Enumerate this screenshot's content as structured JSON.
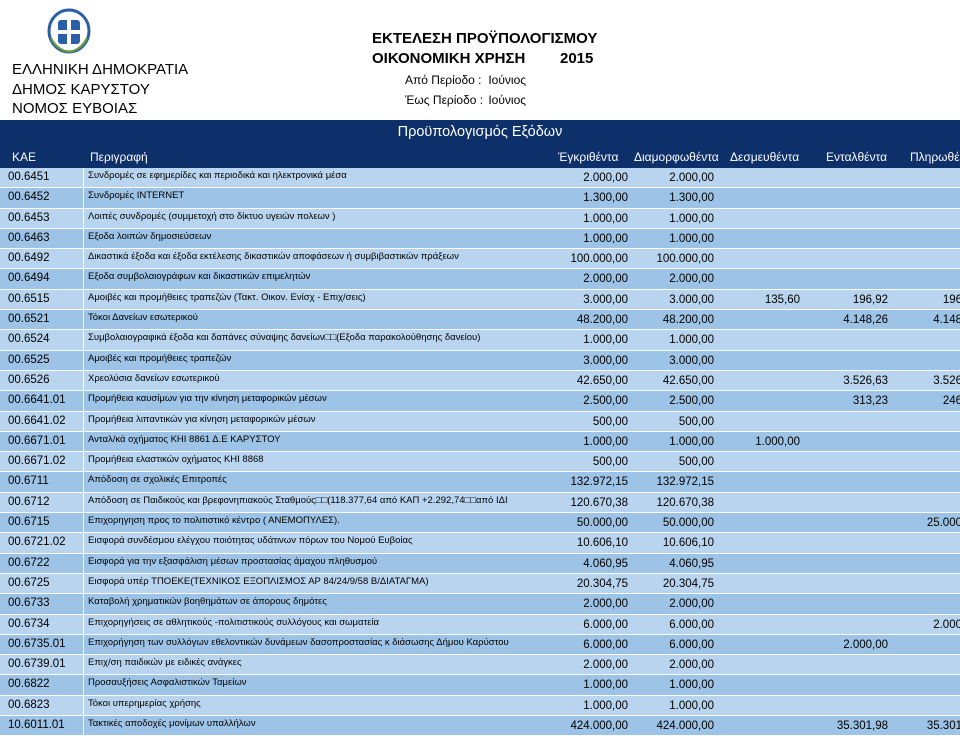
{
  "header": {
    "org_lines": [
      "ΕΛΛΗΝΙΚΗ ΔΗΜΟΚΡΑΤΙΑ",
      "ΔΗΜΟΣ ΚΑΡΥΣΤΟΥ",
      "ΝΟΜΟΣ ΕΥΒΟΙΑΣ"
    ],
    "report_title": "ΕΚΤΕΛΕΣΗ ΠΡΟΫΠΟΛΟΓΙΣΜΟΥ",
    "fiscal_year_label": "ΟΙΚΟΝΟΜΙΚΗ ΧΡΗΣΗ",
    "fiscal_year": "2015",
    "period_from_label": "Από Περίοδο :",
    "period_from": "Ιούνιος",
    "period_to_label": "Έως Περίοδο :",
    "period_to": "Ιούνιος",
    "emblem_icon": "greek-coat-of-arms-icon"
  },
  "section_title": "Προϋπολογισμός Εξόδων",
  "columns": [
    "ΚΑΕ",
    "Περιγραφή",
    "Έγκριθέντα",
    "Διαμορφωθέντα",
    "Δεσμευθέντα",
    "Ενταλθέντα",
    "Πληρωθέ"
  ],
  "colors": {
    "header_bar": "#0d2f6a",
    "row_light": "#b8d4ee",
    "row_dark": "#9dc3e6"
  },
  "rows": [
    {
      "code": "00.6451",
      "desc": "Συνδρομές σε εφημερίδες και περιοδικά και ηλεκτρονικά μέσα",
      "approved": "2.000,00",
      "revised": "2.000,00",
      "committed": "",
      "paid_order": "",
      "paid": ""
    },
    {
      "code": "00.6452",
      "desc": "Συνδρομές INTERNET",
      "approved": "1.300,00",
      "revised": "1.300,00",
      "committed": "",
      "paid_order": "",
      "paid": ""
    },
    {
      "code": "00.6453",
      "desc": "Λοιπές συνδρομές (συμμετοχή στο δίκτυο υγειών πολεων )",
      "approved": "1.000,00",
      "revised": "1.000,00",
      "committed": "",
      "paid_order": "",
      "paid": ""
    },
    {
      "code": "00.6463",
      "desc": "Εξοδα λοιπών δημοσιεύσεων",
      "approved": "1.000,00",
      "revised": "1.000,00",
      "committed": "",
      "paid_order": "",
      "paid": ""
    },
    {
      "code": "00.6492",
      "desc": "Δικαστικά έξοδα και έξοδα εκτέλεσης δικαστικών αποφάσεων ή συμβιβαστικών πράξεων",
      "approved": "100.000,00",
      "revised": "100.000,00",
      "committed": "",
      "paid_order": "",
      "paid": ""
    },
    {
      "code": "00.6494",
      "desc": "Εξοδα συμβολαιογράφων και δικαστικών επιμελητών",
      "approved": "2.000,00",
      "revised": "2.000,00",
      "committed": "",
      "paid_order": "",
      "paid": ""
    },
    {
      "code": "00.6515",
      "desc": "Αμοιβές και προμήθειες τραπεζών (Τακτ. Οικον. Ενίσχ - Επιχ/σεις)",
      "approved": "3.000,00",
      "revised": "3.000,00",
      "committed": "135,60",
      "paid_order": "196,92",
      "paid": "196"
    },
    {
      "code": "00.6521",
      "desc": "Τόκοι Δανείων εσωτερικού",
      "approved": "48.200,00",
      "revised": "48.200,00",
      "committed": "",
      "paid_order": "4.148,26",
      "paid": "4.148"
    },
    {
      "code": "00.6524",
      "desc": "Συμβολαιογραφικά έξοδα και δαπάνες σύναψης δανείων□□(Εξοδα παρακολούθησης δανείου)",
      "approved": "1.000,00",
      "revised": "1.000,00",
      "committed": "",
      "paid_order": "",
      "paid": ""
    },
    {
      "code": "00.6525",
      "desc": "Αμοιβές και προμήθειες τραπεζών",
      "approved": "3.000,00",
      "revised": "3.000,00",
      "committed": "",
      "paid_order": "",
      "paid": ""
    },
    {
      "code": "00.6526",
      "desc": "Χρεολύσια δανείων εσωτερικού",
      "approved": "42.650,00",
      "revised": "42.650,00",
      "committed": "",
      "paid_order": "3.526,63",
      "paid": "3.526"
    },
    {
      "code": "00.6641.01",
      "desc": "Προμήθεια καυσίμων για την κίνηση μεταφορικών μέσων",
      "approved": "2.500,00",
      "revised": "2.500,00",
      "committed": "",
      "paid_order": "313,23",
      "paid": "246"
    },
    {
      "code": "00.6641.02",
      "desc": "Προμήθεια λιπαντικών για κίνηση μεταφορικών μέσων",
      "approved": "500,00",
      "revised": "500,00",
      "committed": "",
      "paid_order": "",
      "paid": ""
    },
    {
      "code": "00.6671.01",
      "desc": "Ανταλ/κά οχήματος ΚΗΙ 8861 Δ.Ε ΚΑΡΥΣΤΟΥ",
      "approved": "1.000,00",
      "revised": "1.000,00",
      "committed": "1.000,00",
      "paid_order": "",
      "paid": ""
    },
    {
      "code": "00.6671.02",
      "desc": "Προμήθεια ελαστικών οχήματος ΚΗΙ 8868",
      "approved": "500,00",
      "revised": "500,00",
      "committed": "",
      "paid_order": "",
      "paid": ""
    },
    {
      "code": "00.6711",
      "desc": "Απόδοση σε σχολικές Επιτροπές",
      "approved": "132.972,15",
      "revised": "132.972,15",
      "committed": "",
      "paid_order": "",
      "paid": ""
    },
    {
      "code": "00.6712",
      "desc": "Απόδοση σε Παιδικούς και βρεφονηπιακούς Σταθμούς□□(118.377,64 από ΚΑΠ +2.292,74□□από ΙΔΙ",
      "approved": "120.670,38",
      "revised": "120.670,38",
      "committed": "",
      "paid_order": "",
      "paid": ""
    },
    {
      "code": "00.6715",
      "desc": "Επιχορηγηση προς το πολιτιστικό κέντρο ( ΑΝΕΜΟΠΥΛΕΣ).",
      "approved": "50.000,00",
      "revised": "50.000,00",
      "committed": "",
      "paid_order": "",
      "paid": "25.000"
    },
    {
      "code": "00.6721.02",
      "desc": "Εισφορά συνδέσμου ελέγχου ποιότητας υδάτινων πόρων του Νομού Ευβοίας",
      "approved": "10.606,10",
      "revised": "10.606,10",
      "committed": "",
      "paid_order": "",
      "paid": ""
    },
    {
      "code": "00.6722",
      "desc": "Εισφορά για την εξασφάλιση μέσων προστασίας άμαχου πληθυσμού",
      "approved": "4.060,95",
      "revised": "4.060,95",
      "committed": "",
      "paid_order": "",
      "paid": ""
    },
    {
      "code": "00.6725",
      "desc": "Εισφορά υπέρ ΤΠΟΕΚΕ(ΤΕΧΝΙΚΟΣ ΕΞΟΠΛΙΣΜΟΣ ΑΡ 84/24/9/58 Β/ΔΙΑΤΑΓΜΑ)",
      "approved": "20.304,75",
      "revised": "20.304,75",
      "committed": "",
      "paid_order": "",
      "paid": ""
    },
    {
      "code": "00.6733",
      "desc": "Καταβολή χρηματικών βοηθημάτων σε άπορους δημότες",
      "approved": "2.000,00",
      "revised": "2.000,00",
      "committed": "",
      "paid_order": "",
      "paid": ""
    },
    {
      "code": "00.6734",
      "desc": "Επιχορηγήσεις σε αθλητικούς -πολιτιστικούς συλλόγους και σωματεία",
      "approved": "6.000,00",
      "revised": "6.000,00",
      "committed": "",
      "paid_order": "",
      "paid": "2.000"
    },
    {
      "code": "00.6735.01",
      "desc": "Επιχορήγηση των συλλόγων εθελοντικών δυνάμεων δασοπροστασίας κ διάσωσης Δήμου Καρύστου",
      "approved": "6.000,00",
      "revised": "6.000,00",
      "committed": "",
      "paid_order": "2.000,00",
      "paid": ""
    },
    {
      "code": "00.6739.01",
      "desc": "Επιχ/ση παιδικών με ειδικές ανάγκες",
      "approved": "2.000,00",
      "revised": "2.000,00",
      "committed": "",
      "paid_order": "",
      "paid": ""
    },
    {
      "code": "00.6822",
      "desc": "Προσαυξήσεις Ασφαλιστικών Ταμείων",
      "approved": "1.000,00",
      "revised": "1.000,00",
      "committed": "",
      "paid_order": "",
      "paid": ""
    },
    {
      "code": "00.6823",
      "desc": "Τόκοι υπερημερίας χρήσης",
      "approved": "1.000,00",
      "revised": "1.000,00",
      "committed": "",
      "paid_order": "",
      "paid": ""
    },
    {
      "code": "10.6011.01",
      "desc": "Τακτικές αποδοχές μονίμων υπαλλήλων",
      "approved": "424.000,00",
      "revised": "424.000,00",
      "committed": "",
      "paid_order": "35.301,98",
      "paid": "35.301"
    }
  ]
}
